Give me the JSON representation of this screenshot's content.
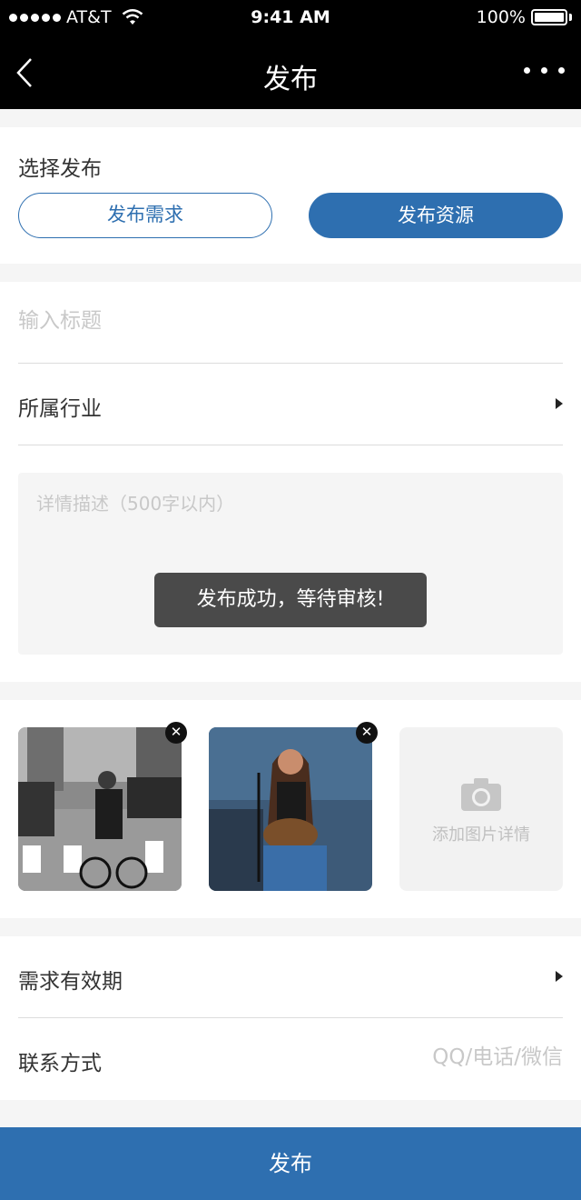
{
  "status_bar": {
    "carrier": "AT&T",
    "time": "9:41 AM",
    "battery": "100%"
  },
  "nav": {
    "title": "发布",
    "back_icon": "chevron-left-icon",
    "more_icon": "more-dots-icon"
  },
  "choose": {
    "label": "选择发布",
    "option_demand": "发布需求",
    "option_resource": "发布资源",
    "selected": "发布资源"
  },
  "form": {
    "title_placeholder": "输入标题",
    "industry_label": "所属行业",
    "desc_placeholder": "详情描述（500字以内）"
  },
  "toast": "发布成功，等待审核!",
  "photos": {
    "add_label": "添加图片详情",
    "remove_icon": "close-icon",
    "camera_icon": "camera-icon"
  },
  "meta": {
    "validity_label": "需求有效期",
    "contact_label": "联系方式",
    "contact_placeholder": "QQ/电话/微信"
  },
  "publish_button": "发布",
  "colors": {
    "accent": "#2e6fb0",
    "nav_bg": "#000000",
    "toast_bg": "#4a4a4a"
  }
}
